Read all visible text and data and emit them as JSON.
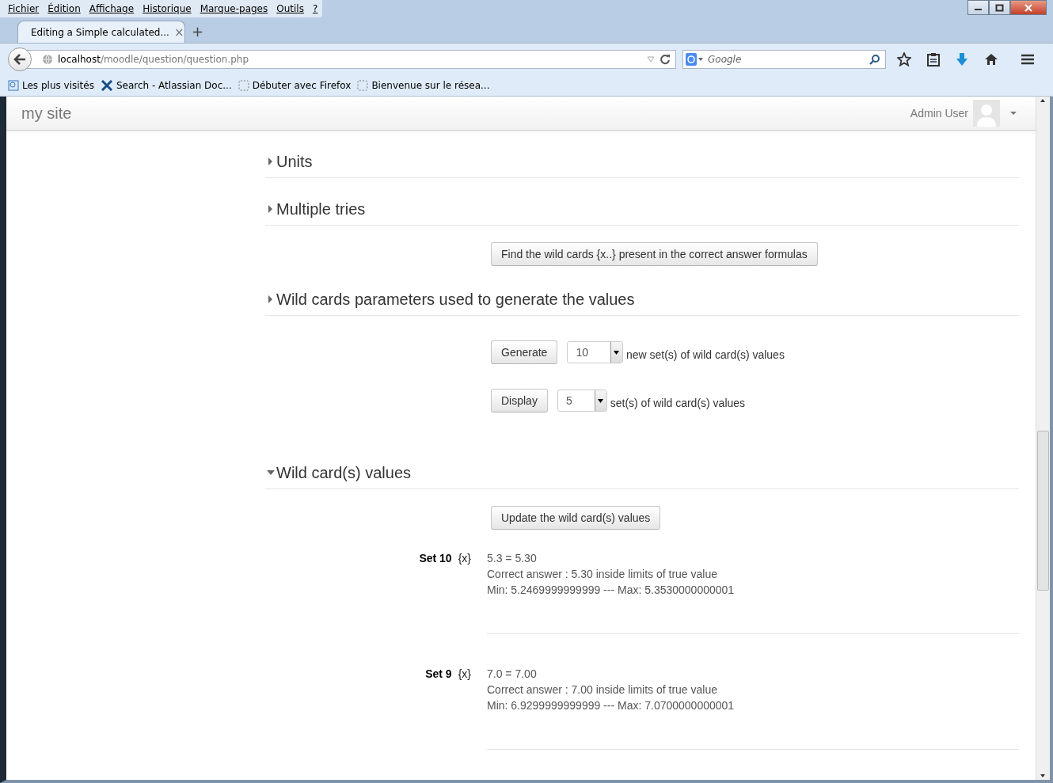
{
  "menu_bar": [
    {
      "label": "Fichier"
    },
    {
      "label": "Édition"
    },
    {
      "label": "Affichage"
    },
    {
      "label": "Historique"
    },
    {
      "label": "Marque-pages"
    },
    {
      "label": "Outils"
    },
    {
      "label": "?"
    }
  ],
  "tabs": [
    {
      "title": "Editing a Simple calculated...",
      "close": "×",
      "selected": true
    }
  ],
  "new_tab": "+",
  "address": {
    "host": "localhost",
    "path": "/moodle/question/question.php"
  },
  "search": {
    "placeholder": "Google"
  },
  "bookmarks": [
    {
      "label": "Les plus visités",
      "kind": "folder"
    },
    {
      "label": "Search - Atlassian Doc...",
      "kind": "tool"
    },
    {
      "label": "Débuter avec Firefox",
      "kind": "page"
    },
    {
      "label": "Bienvenue sur le résea...",
      "kind": "page"
    }
  ],
  "site": {
    "name": "my site",
    "user": "Admin User"
  },
  "blocks": [
    {
      "kind": "section",
      "title": "Units",
      "expanded": false
    },
    {
      "kind": "section",
      "title": "Multiple tries",
      "expanded": false
    },
    {
      "kind": "button",
      "label": "Find the wild cards {x..} present in the correct answer formulas"
    },
    {
      "kind": "section",
      "title": "Wild cards parameters used to generate the values",
      "expanded": false
    },
    {
      "kind": "select_row",
      "button": "Generate",
      "value": "10",
      "text": "new set(s) of wild card(s) values"
    },
    {
      "kind": "select_row",
      "button": "Display",
      "value": "5",
      "text": "set(s) of wild card(s) values"
    },
    {
      "kind": "section",
      "title": "Wild card(s) values",
      "expanded": true
    },
    {
      "kind": "button",
      "label": "Update the wild card(s) values"
    },
    {
      "kind": "set",
      "label": "Set 10",
      "wildcard": "{x}",
      "lines": [
        "5.3 = 5.30",
        "Correct answer : 5.30 inside limits of true value",
        "Min: 5.2469999999999 --- Max: 5.3530000000001"
      ]
    },
    {
      "kind": "set",
      "label": "Set 9",
      "wildcard": "{x}",
      "lines": [
        "7.0 = 7.00",
        "Correct answer : 7.00 inside limits of true value",
        "Min: 6.9299999999999 --- Max: 7.0700000000001"
      ]
    }
  ]
}
